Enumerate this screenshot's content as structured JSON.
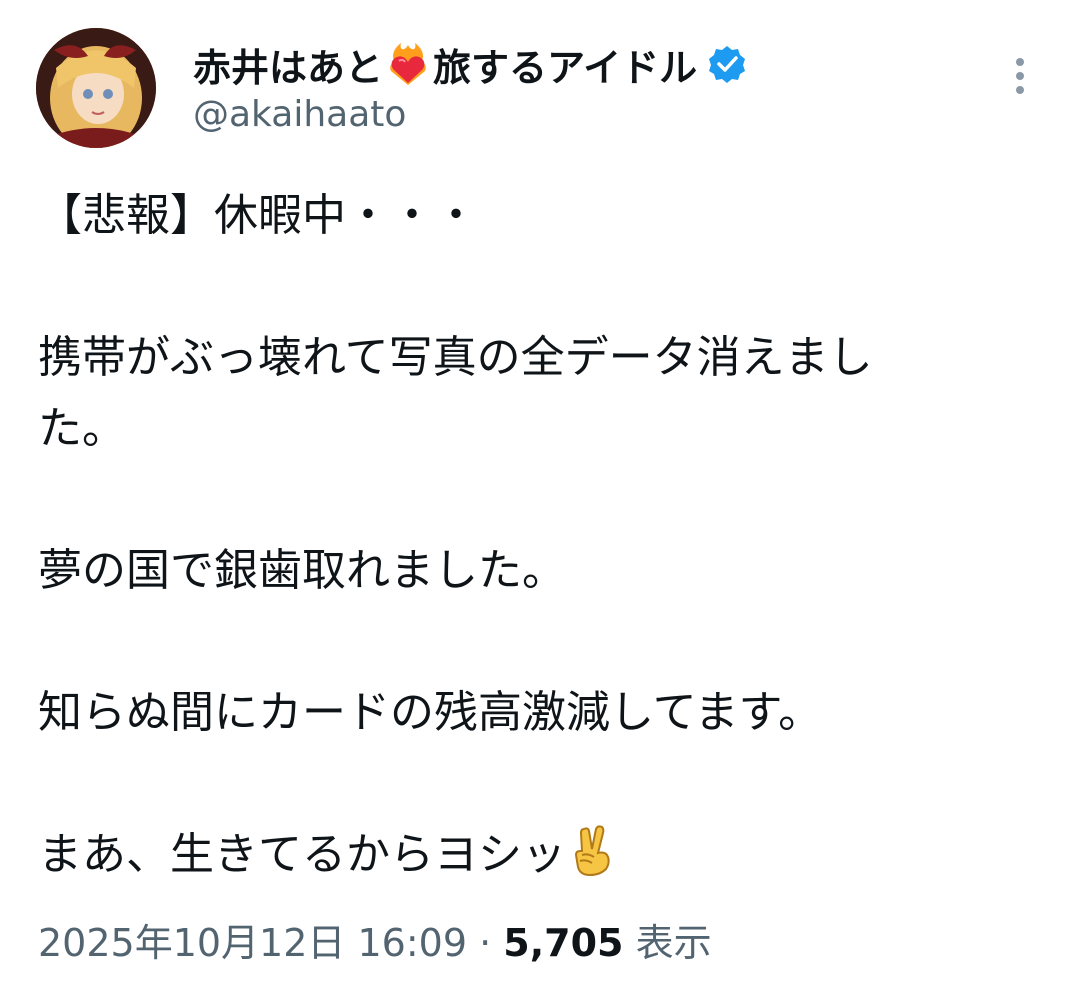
{
  "user": {
    "display_name_prefix": "赤井はあと",
    "display_name_suffix": "旅するアイドル",
    "heart_icon": "flaming-heart-icon",
    "verified_icon": "verified-badge-icon",
    "handle": "@akaihaato",
    "accent_color": "#1d9bf0"
  },
  "tweet": {
    "lines": [
      "【悲報】休暇中・・・",
      "",
      "携帯がぶっ壊れて写真の全データ消えまし",
      "た。",
      "",
      "夢の国で銀歯取れました。",
      "",
      "知らぬ間にカードの残高激減してます。",
      "",
      "まあ、生きてるからヨシッ"
    ],
    "ending_icon": "victory-hand-icon"
  },
  "meta": {
    "timestamp": "2025年10月12日 16:09",
    "separator": "·",
    "views_count": "5,705",
    "views_label": "表示"
  },
  "menu": {
    "more_icon": "more-options-icon"
  }
}
